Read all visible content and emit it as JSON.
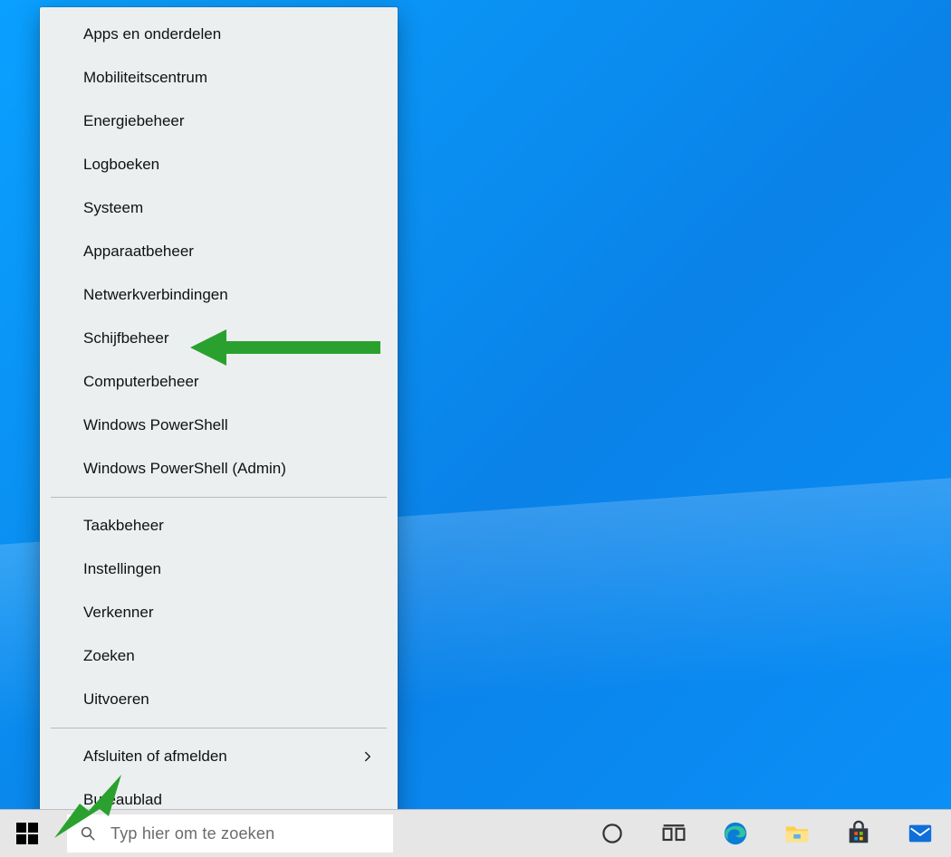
{
  "menu": {
    "groups": [
      [
        {
          "label": "Apps en onderdelen",
          "name": "menu-apps-and-features"
        },
        {
          "label": "Mobiliteitscentrum",
          "name": "menu-mobility-center"
        },
        {
          "label": "Energiebeheer",
          "name": "menu-power-options"
        },
        {
          "label": "Logboeken",
          "name": "menu-event-viewer"
        },
        {
          "label": "Systeem",
          "name": "menu-system"
        },
        {
          "label": "Apparaatbeheer",
          "name": "menu-device-manager"
        },
        {
          "label": "Netwerkverbindingen",
          "name": "menu-network-connections"
        },
        {
          "label": "Schijfbeheer",
          "name": "menu-disk-management"
        },
        {
          "label": "Computerbeheer",
          "name": "menu-computer-management"
        },
        {
          "label": "Windows PowerShell",
          "name": "menu-powershell"
        },
        {
          "label": "Windows PowerShell (Admin)",
          "name": "menu-powershell-admin"
        }
      ],
      [
        {
          "label": "Taakbeheer",
          "name": "menu-task-manager"
        },
        {
          "label": "Instellingen",
          "name": "menu-settings"
        },
        {
          "label": "Verkenner",
          "name": "menu-file-explorer"
        },
        {
          "label": "Zoeken",
          "name": "menu-search"
        },
        {
          "label": "Uitvoeren",
          "name": "menu-run"
        }
      ],
      [
        {
          "label": "Afsluiten of afmelden",
          "name": "menu-shutdown-signout",
          "submenu": true
        },
        {
          "label": "Bureaublad",
          "name": "menu-desktop"
        }
      ]
    ]
  },
  "taskbar": {
    "search_placeholder": "Typ hier om te zoeken"
  }
}
